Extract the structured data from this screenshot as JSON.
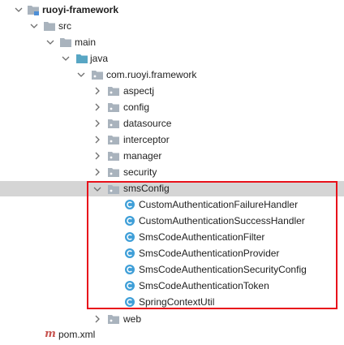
{
  "tree": {
    "root": {
      "label": "ruoyi-framework"
    },
    "src": {
      "label": "src"
    },
    "main": {
      "label": "main"
    },
    "java": {
      "label": "java"
    },
    "package": {
      "label": "com.ruoyi.framework"
    },
    "folders": [
      {
        "label": "aspectj"
      },
      {
        "label": "config"
      },
      {
        "label": "datasource"
      },
      {
        "label": "interceptor"
      },
      {
        "label": "manager"
      },
      {
        "label": "security"
      }
    ],
    "smsConfig": {
      "label": "smsConfig",
      "classes": [
        {
          "label": "CustomAuthenticationFailureHandler"
        },
        {
          "label": "CustomAuthenticationSuccessHandler"
        },
        {
          "label": "SmsCodeAuthenticationFilter"
        },
        {
          "label": "SmsCodeAuthenticationProvider"
        },
        {
          "label": "SmsCodeAuthenticationSecurityConfig"
        },
        {
          "label": "SmsCodeAuthenticationToken"
        },
        {
          "label": "SpringContextUtil"
        }
      ]
    },
    "web": {
      "label": "web"
    },
    "pom": {
      "label": "pom.xml"
    }
  },
  "colors": {
    "highlight_border": "#e8121b",
    "selected_row": "#d5d5d5",
    "class_icon": "#3f9fd8",
    "folder": "#a9b3bd",
    "source_folder": "#58a6c4"
  }
}
